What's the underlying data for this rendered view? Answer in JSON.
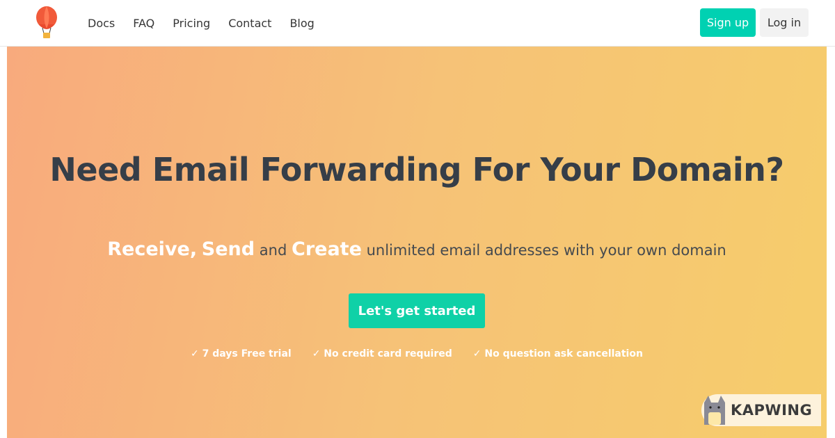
{
  "nav": {
    "links": [
      "Docs",
      "FAQ",
      "Pricing",
      "Contact",
      "Blog"
    ],
    "signup_label": "Sign up",
    "login_label": "Log in"
  },
  "hero": {
    "headline": "Need Email Forwarding For Your Domain?",
    "subline": {
      "word1": "Receive,",
      "word2": "Send",
      "connector": "and",
      "word3": "Create",
      "rest": "unlimited email addresses with your own domain"
    },
    "cta_label": "Let's get started",
    "features": [
      "✓ 7 days Free trial",
      "✓ No credit card required",
      "✓ No question ask cancellation"
    ]
  },
  "watermark": {
    "text": "KAPWING"
  },
  "colors": {
    "accent": "#00d1b2",
    "headline": "#363e48",
    "gradient_start": "#f8aa7d",
    "gradient_end": "#f6cd6b"
  },
  "icons": [
    "hot-air-balloon-icon",
    "cat-mascot-icon"
  ]
}
